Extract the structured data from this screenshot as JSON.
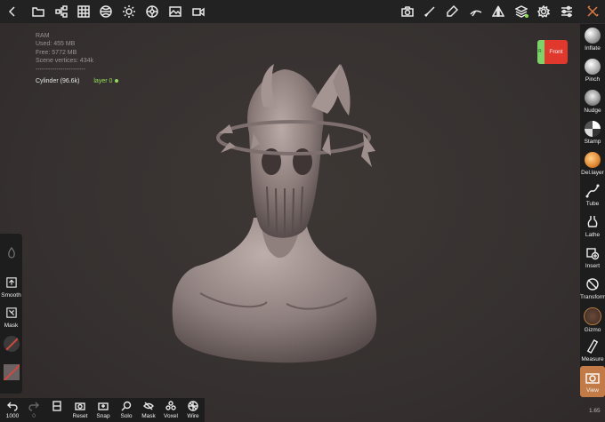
{
  "topbar": {
    "left_icons": [
      "back-arrow-icon",
      "folder-icon",
      "scene-tree-icon",
      "grid-icon",
      "material-sphere-icon",
      "light-sun-icon",
      "settings-wheel-icon",
      "image-icon",
      "video-icon"
    ],
    "right_icons": [
      "camera-icon",
      "brush-icon",
      "eraser-icon",
      "stabilizer-icon",
      "symmetry-icon",
      "layers-icon",
      "gear-icon",
      "sliders-icon",
      "tools-icon"
    ]
  },
  "info": {
    "ram_label": "RAM",
    "used": "Used: 455 MB",
    "free": "Free: 5772 MB",
    "vertices": "Scene vertices: 434k",
    "separator": "------------------------",
    "object": "Cylinder (96.6k)",
    "layer": "layer 0"
  },
  "cube": {
    "front_label": "Front",
    "side_label": "R",
    "front_color": "#e0382c",
    "side_color": "#7bd36a"
  },
  "tools": [
    {
      "label": "Inflate",
      "icon": "inflate-icon"
    },
    {
      "label": "Pinch",
      "icon": "pinch-icon"
    },
    {
      "label": "Nudge",
      "icon": "nudge-icon"
    },
    {
      "label": "Stamp",
      "icon": "stamp-icon"
    },
    {
      "label": "Del.layer",
      "icon": "delete-layer-icon"
    },
    {
      "label": "Tube",
      "icon": "tube-icon"
    },
    {
      "label": "Lathe",
      "icon": "lathe-icon"
    },
    {
      "label": "Insert",
      "icon": "insert-icon"
    },
    {
      "label": "Transform",
      "icon": "transform-icon"
    },
    {
      "label": "Gizmo",
      "icon": "gizmo-icon"
    },
    {
      "label": "Measure",
      "icon": "measure-icon"
    },
    {
      "label": "View",
      "icon": "view-camera-icon"
    }
  ],
  "active_tool": "View",
  "left_panel": {
    "smooth_label": "Smooth",
    "mask_label": "Mask",
    "primary_color": "#3a3a3a",
    "secondary_color": "#d2483e"
  },
  "bottom": {
    "undo_count": "1000",
    "redo_count": "0",
    "items": [
      {
        "label": "Reset",
        "icon": "reset-camera-icon"
      },
      {
        "label": "Snap",
        "icon": "snap-icon"
      },
      {
        "label": "Solo",
        "icon": "solo-search-icon"
      },
      {
        "label": "Mask",
        "icon": "mask-eye-icon"
      },
      {
        "label": "Voxel",
        "icon": "voxel-icon"
      },
      {
        "label": "Wire",
        "icon": "wireframe-icon"
      }
    ]
  },
  "zoom_level": "1.65"
}
